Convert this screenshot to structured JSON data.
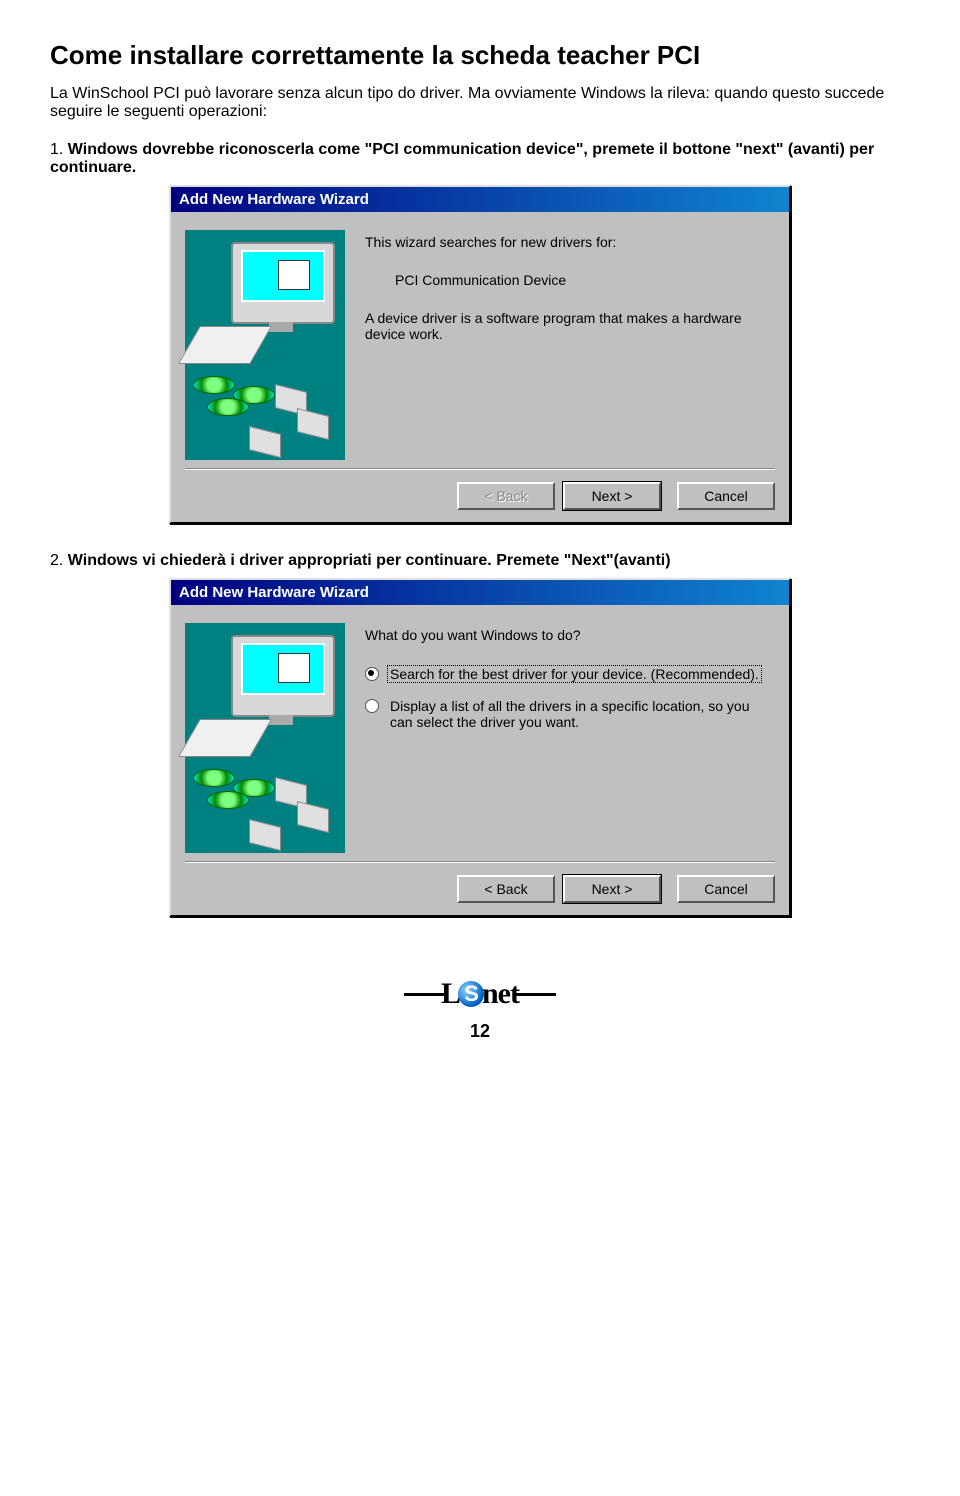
{
  "heading": "Come installare correttamente la scheda teacher PCI",
  "intro": "La WinSchool PCI può lavorare senza alcun tipo do driver. Ma ovviamente Windows la rileva: quando questo succede seguire le seguenti operazioni:",
  "step1": {
    "num": "1.",
    "text_a": "Windows dovrebbe riconoscerla come \"PCI communication device\", premete il bottone \"next\" (avanti) per continuare."
  },
  "step2": {
    "num": "2.",
    "text_a": "Windows vi chiederà i driver appropriati per continuare. Premete \"Next\"(avanti)"
  },
  "wizard": {
    "title": "Add New Hardware Wizard",
    "w1": {
      "line1": "This wizard searches for new drivers for:",
      "device": "PCI Communication Device",
      "desc": "A device driver is a software program that makes a hardware device work."
    },
    "w2": {
      "prompt": "What do you want Windows to do?",
      "opt1": "Search for the best driver for your device. (Recommended).",
      "opt2": "Display a list of all the drivers in a specific location, so you can select the driver you want."
    },
    "buttons": {
      "back": "< Back",
      "next": "Next >",
      "cancel": "Cancel"
    }
  },
  "logo": {
    "a": "L",
    "b": "S",
    "c": "net"
  },
  "pagenum": "12"
}
